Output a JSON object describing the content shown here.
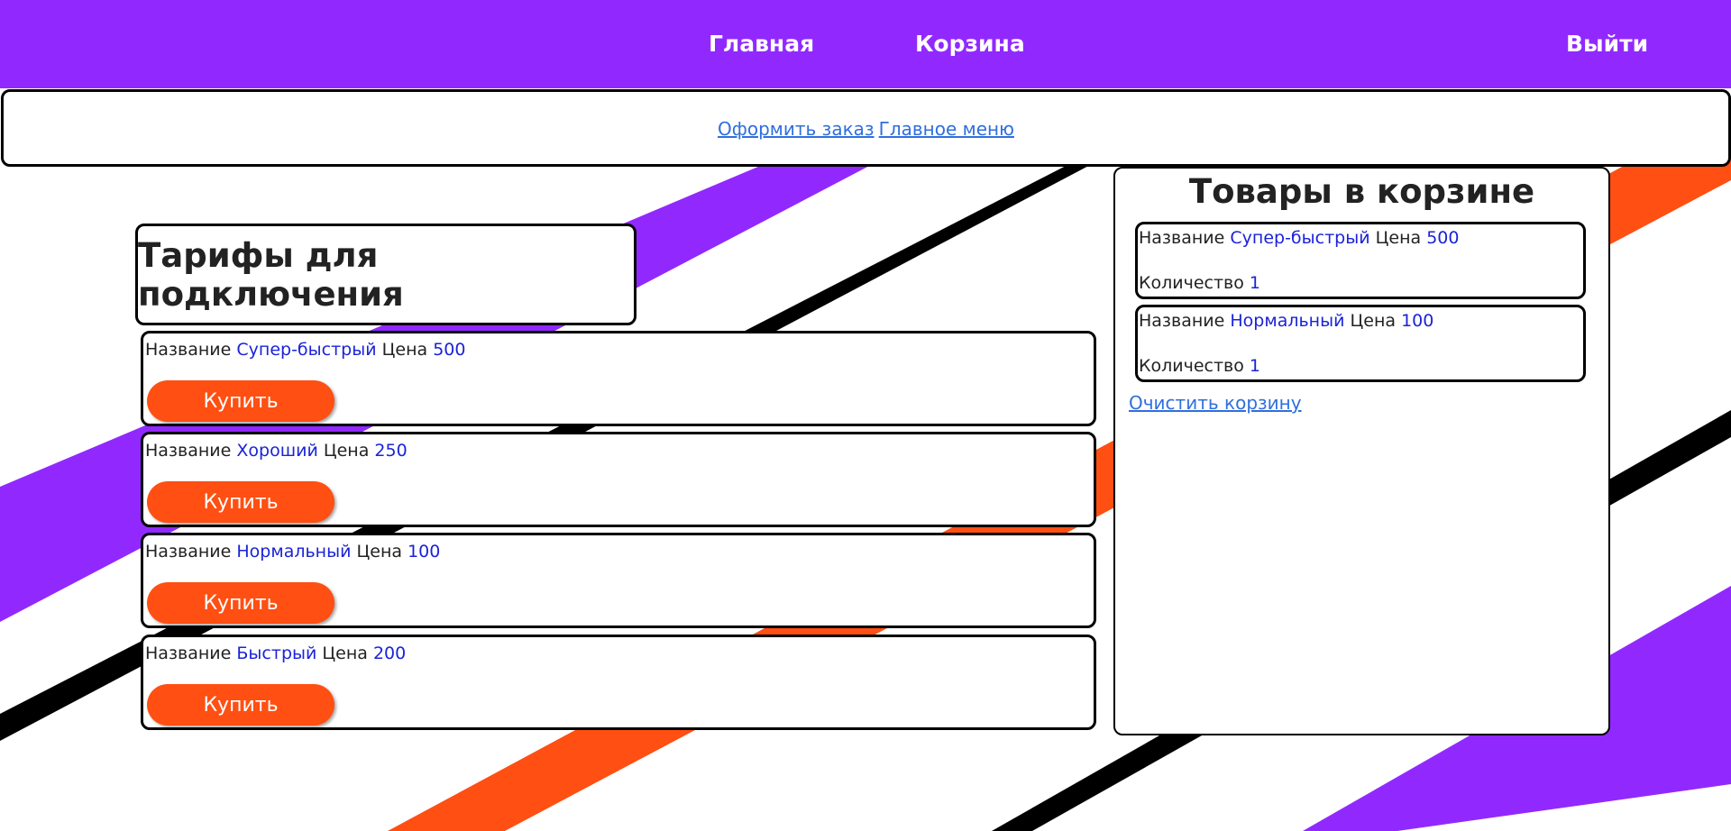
{
  "colors": {
    "brand_purple": "#9129ff",
    "accent_orange": "#ff4f12",
    "stripe_black": "#000000",
    "value_blue": "#1a23d8",
    "link_blue": "#2f6fdd"
  },
  "nav": {
    "home": "Главная",
    "cart": "Корзина",
    "logout": "Выйти"
  },
  "subnav": {
    "checkout": "Оформить заказ",
    "main_menu": "Главное меню"
  },
  "tariffs": {
    "title": "Тарифы для подключения",
    "name_label": "Название",
    "price_label": "Цена",
    "buy_label": "Купить",
    "items": [
      {
        "name": "Супер-быстрый",
        "price": "500"
      },
      {
        "name": "Хороший",
        "price": "250"
      },
      {
        "name": "Нормальный",
        "price": "100"
      },
      {
        "name": "Быстрый",
        "price": "200"
      }
    ]
  },
  "cart": {
    "title": "Товары в корзине",
    "name_label": "Название",
    "price_label": "Цена",
    "qty_label": "Количество",
    "items": [
      {
        "name": "Супер-быстрый",
        "price": "500",
        "qty": "1"
      },
      {
        "name": "Нормальный",
        "price": "100",
        "qty": "1"
      }
    ],
    "clear_label": "Очистить корзину"
  }
}
